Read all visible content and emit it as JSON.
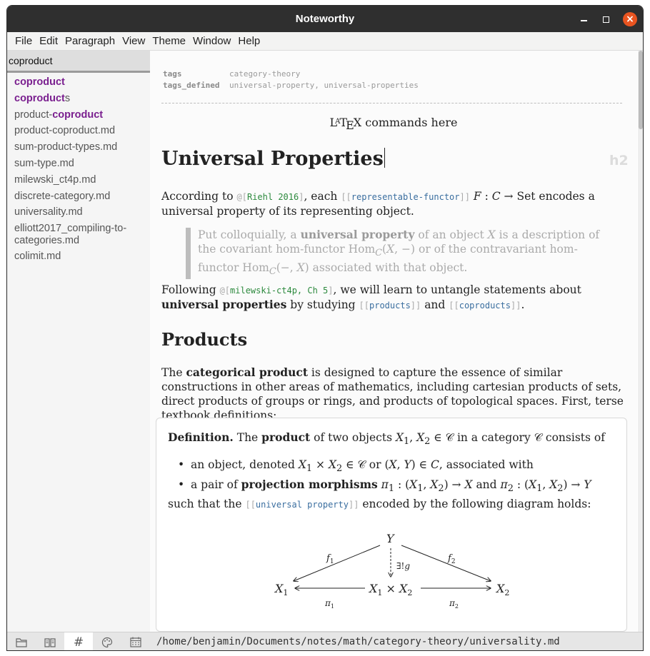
{
  "window": {
    "title": "Noteworthy",
    "controls": {
      "minimize": "minimize",
      "maximize": "maximize",
      "close": "×"
    }
  },
  "menu": [
    "File",
    "Edit",
    "Paragraph",
    "View",
    "Theme",
    "Window",
    "Help"
  ],
  "sidebar": {
    "search_value": "coproduct",
    "files": [
      {
        "pre": "",
        "hl": "coproduct",
        "post": ""
      },
      {
        "pre": "",
        "hl": "coproduct",
        "post": "s"
      },
      {
        "pre": "product-",
        "hl": "coproduct",
        "post": ""
      },
      {
        "pre": "product-coproduct.md",
        "hl": "",
        "post": ""
      },
      {
        "pre": "sum-product-types.md",
        "hl": "",
        "post": ""
      },
      {
        "pre": "sum-type.md",
        "hl": "",
        "post": ""
      },
      {
        "pre": "milewski_ct4p.md",
        "hl": "",
        "post": ""
      },
      {
        "pre": "discrete-category.md",
        "hl": "",
        "post": ""
      },
      {
        "pre": "universality.md",
        "hl": "",
        "post": ""
      },
      {
        "pre": "elliott2017_compiling-to-categories.md",
        "hl": "",
        "post": ""
      },
      {
        "pre": "colimit.md",
        "hl": "",
        "post": ""
      }
    ]
  },
  "bottombar": {
    "tabs": [
      "folder-icon",
      "book-icon",
      "hash-icon",
      "palette-icon",
      "calendar-icon"
    ],
    "active_tab": 2,
    "path": "/home/benjamin/Documents/notes/math/category-theory/universality.md"
  },
  "document": {
    "frontmatter": {
      "tags_key": "tags",
      "tags_value": "category-theory",
      "defined_key": "tags_defined",
      "defined_value": "universal-property, universal-properties"
    },
    "latex_line": "commands here",
    "h1": "Universal Properties",
    "heading_tag": "h2",
    "p1": {
      "t1": "According to",
      "cite": "Riehl 2016",
      "t2": ", each",
      "link": "representable-functor",
      "t3": "encodes a universal property of its representing object."
    },
    "quote": {
      "t1": "Put colloquially, a",
      "b1": "universal property",
      "t2": "of an object",
      "t3": "is a description of the covariant hom-functor",
      "t4": "or of the contravariant hom-functor",
      "t5": "associated with that object."
    },
    "p2": {
      "t1": "Following",
      "cite": "milewski-ct4p, Ch 5",
      "t2": ", we will learn to untangle statements about",
      "b1": "universal properties",
      "t3": "by studying",
      "link1": "products",
      "t4": "and",
      "link2": "coproducts",
      "t5": "."
    },
    "h2": "Products",
    "p3": {
      "t1": "The",
      "b1": "categorical product",
      "t2": "is designed to capture the essence of similar constructions in other areas of mathematics, including cartesian products of sets, direct products of groups or rings, and products of topological spaces.  First, terse textbook definitions:"
    },
    "definition": {
      "label": "Definition.",
      "t1": "The",
      "b1": "product",
      "t2": "of two objects",
      "t3": "in a category",
      "t4": "consists of",
      "bullet1_t1": "an object, denoted",
      "bullet1_t2": "or",
      "bullet1_t3": ", associated with",
      "bullet2_t1": "a pair of",
      "bullet2_b1": "projection morphisms",
      "bullet2_t2": "and",
      "such_t1": "such that the",
      "such_link": "universal property",
      "such_t2": "encoded by the following diagram holds:"
    }
  }
}
